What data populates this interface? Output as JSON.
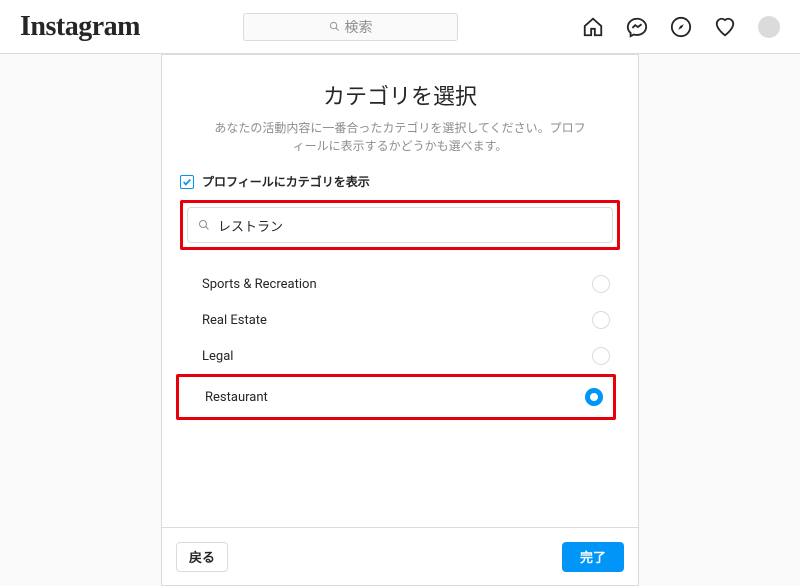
{
  "header": {
    "logo_text": "Instagram",
    "search_placeholder": "検索"
  },
  "main": {
    "title": "カテゴリを選択",
    "subtitle": "あなたの活動内容に一番合ったカテゴリを選択してください。プロフィールに表示するかどうかも選べます。",
    "show_on_profile_label": "プロフィールにカテゴリを表示",
    "show_on_profile_checked": true,
    "search_value": "レストラン",
    "options": [
      {
        "label": "Sports & Recreation",
        "selected": false
      },
      {
        "label": "Real Estate",
        "selected": false
      },
      {
        "label": "Legal",
        "selected": false
      },
      {
        "label": "Restaurant",
        "selected": true
      }
    ]
  },
  "footer": {
    "back_label": "戻る",
    "done_label": "完了"
  }
}
